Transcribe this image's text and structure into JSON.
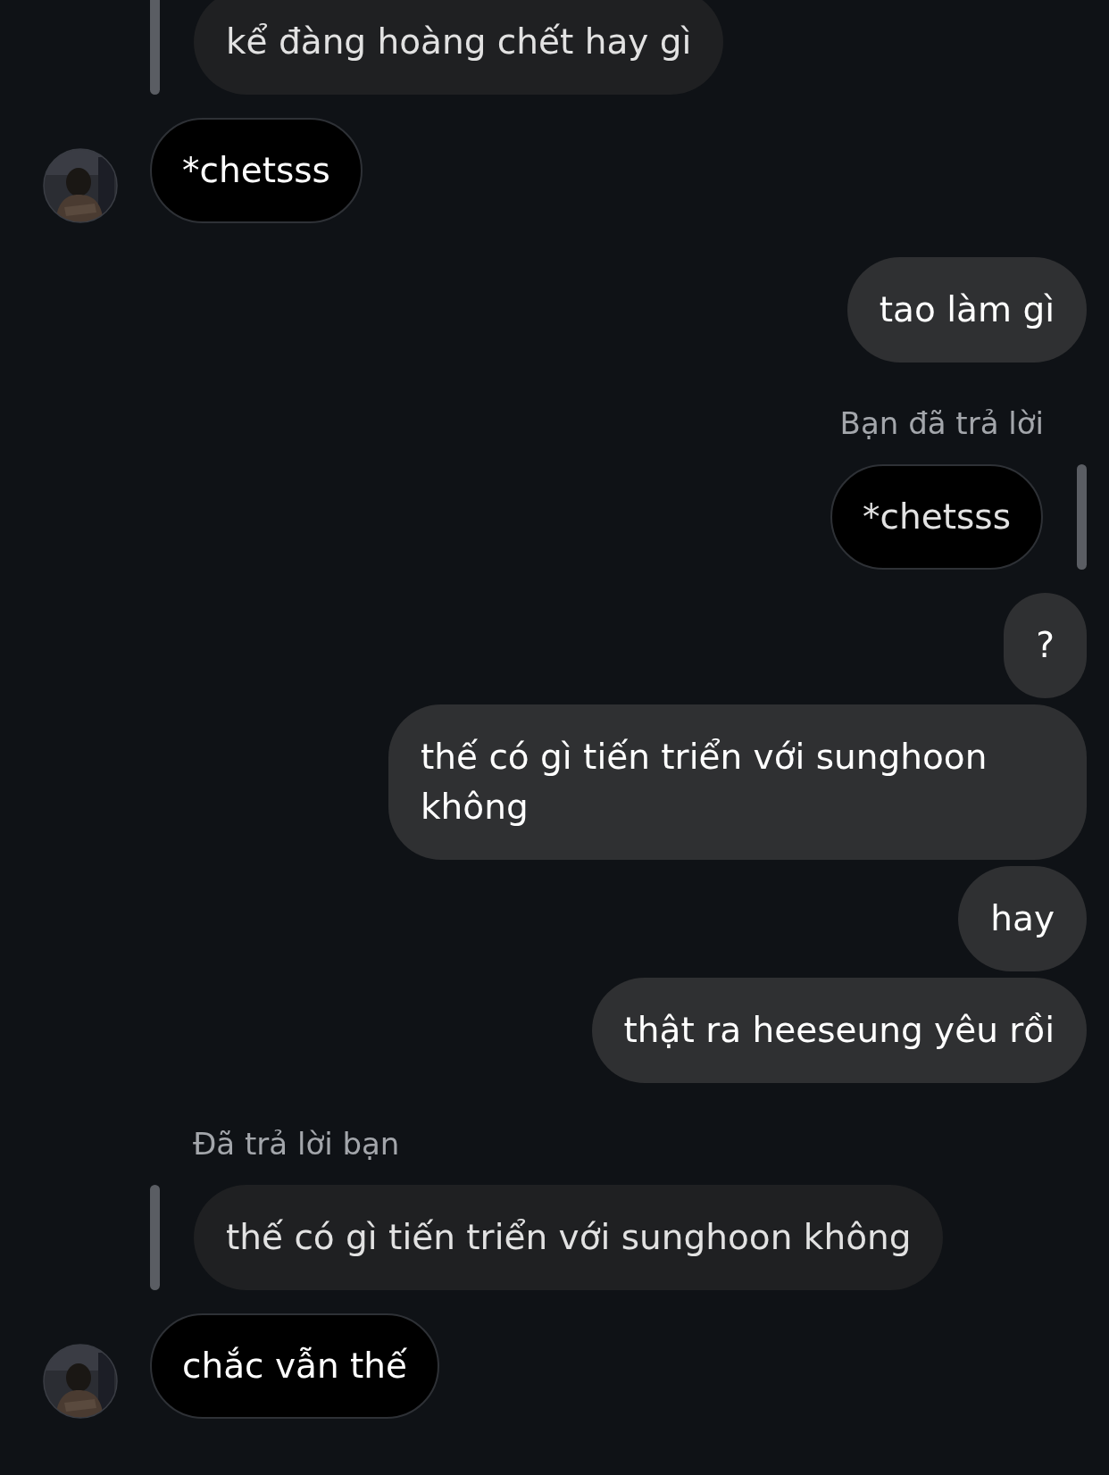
{
  "messages": [
    {
      "kind": "quote",
      "outgoing": false,
      "quotes_own": true,
      "text": "kể đàng hoàng chết hay gì"
    },
    {
      "kind": "message",
      "outgoing": false,
      "text": "*chetsss"
    },
    {
      "kind": "message",
      "outgoing": true,
      "text": "tao làm gì"
    },
    {
      "kind": "label",
      "outgoing": true,
      "text": "Bạn đã trả lời"
    },
    {
      "kind": "quote",
      "outgoing": true,
      "quotes_own": false,
      "text": "*chetsss"
    },
    {
      "kind": "message",
      "outgoing": true,
      "text": "?"
    },
    {
      "kind": "message",
      "outgoing": true,
      "text": "thế có gì tiến triển với sunghoon không"
    },
    {
      "kind": "message",
      "outgoing": true,
      "text": "hay"
    },
    {
      "kind": "message",
      "outgoing": true,
      "text": "thật ra heeseung yêu rồi"
    },
    {
      "kind": "label",
      "outgoing": false,
      "text": "Đã trả lời bạn"
    },
    {
      "kind": "quote",
      "outgoing": false,
      "quotes_own": true,
      "text": "thế có gì tiến triển với sunghoon không"
    },
    {
      "kind": "message",
      "outgoing": false,
      "text": "chắc vẫn thế"
    }
  ]
}
